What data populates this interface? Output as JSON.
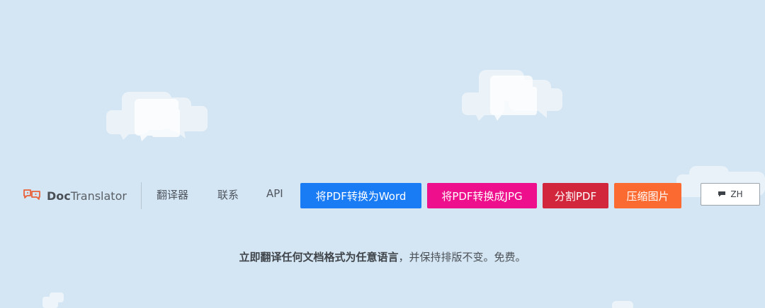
{
  "header": {
    "brand": {
      "bold": "Doc",
      "rest": "Translator",
      "icon": "chat-bubbles-logo-icon"
    },
    "nav": [
      {
        "label": "翻译器"
      },
      {
        "label": "联系"
      },
      {
        "label": "API"
      }
    ],
    "tool_buttons": [
      {
        "label": "将PDF转换为Word",
        "color": "#1a7cf5"
      },
      {
        "label": "将PDF转换成JPG",
        "color": "#ee0f8c"
      },
      {
        "label": "分割PDF",
        "color": "#d1263c"
      },
      {
        "label": "压缩图片",
        "color": "#fb6b31"
      }
    ],
    "language": {
      "label": "ZH",
      "icon": "speech-bubble-icon"
    }
  },
  "tagline": {
    "strong": "立即翻译任何文档格式为任意语言",
    "rest": "，并保持排版不变。免费。"
  },
  "colors": {
    "background": "#d4e6f3",
    "brand_accent": "#e8613a"
  }
}
